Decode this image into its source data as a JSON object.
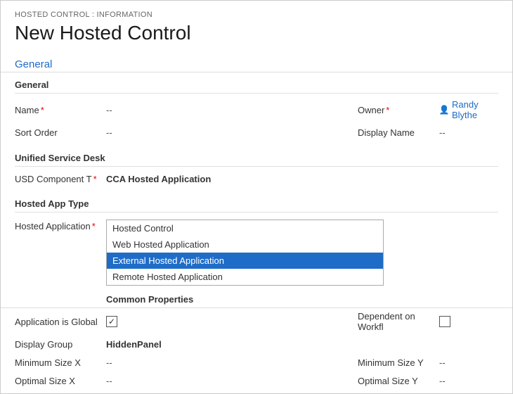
{
  "breadcrumb": "HOSTED CONTROL : INFORMATION",
  "page_title": "New Hosted Control",
  "section_general_header": "General",
  "groups": {
    "general": {
      "label": "General",
      "fields": [
        {
          "label": "Name",
          "required": true,
          "value": "--",
          "right_label": "Owner",
          "right_required": true,
          "right_value": "Randy Blythe",
          "right_type": "owner"
        },
        {
          "label": "Sort Order",
          "required": false,
          "value": "--",
          "right_label": "Display Name",
          "right_required": false,
          "right_value": "--",
          "right_type": "text"
        }
      ]
    },
    "usd": {
      "label": "Unified Service Desk",
      "fields": [
        {
          "label": "USD Component T",
          "required": true,
          "value": "CCA Hosted Application"
        }
      ]
    },
    "hosted_app_type": {
      "label": "Hosted App Type"
    }
  },
  "hosted_application_label": "Hosted Application",
  "hosted_application_required": true,
  "dropdown_items": [
    {
      "text": "Hosted Control",
      "selected": false
    },
    {
      "text": "Web Hosted Application",
      "selected": false
    },
    {
      "text": "External Hosted Application",
      "selected": true
    },
    {
      "text": "Remote Hosted Application",
      "selected": false
    }
  ],
  "common_properties_label": "Common Properties",
  "common_fields": [
    {
      "label": "Application is Global",
      "value": "",
      "checked": true,
      "right_label": "Dependent on Workfl",
      "right_checked": false
    },
    {
      "label": "Display Group",
      "value": "HiddenPanel",
      "bold": true
    },
    {
      "label": "Minimum Size X",
      "value": "--",
      "right_label": "Minimum Size Y",
      "right_value": "--"
    },
    {
      "label": "Optimal Size X",
      "value": "--",
      "right_label": "Optimal Size Y",
      "right_value": "--"
    }
  ]
}
